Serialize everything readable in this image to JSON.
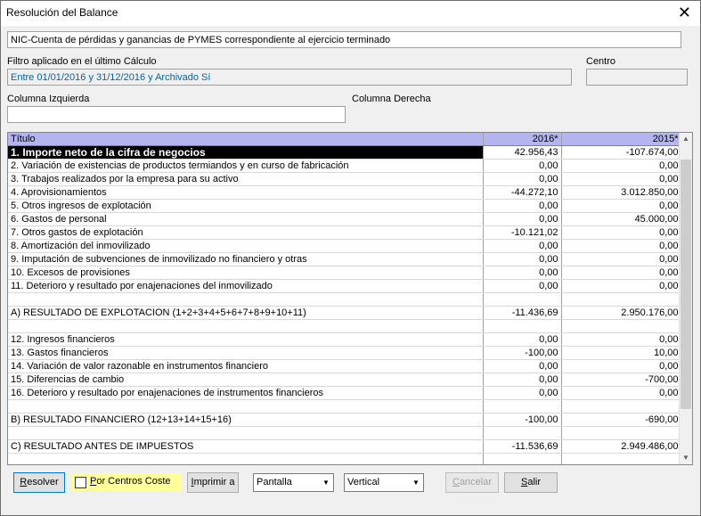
{
  "window": {
    "title": "Resolución del Balance",
    "close": "✕"
  },
  "report_name": "NIC-Cuenta de pérdidas y ganancias de PYMES correspondiente al ejercicio terminado",
  "filter_label": "Filtro aplicado en el último Cálculo",
  "filter_value": "Entre 01/01/2016 y 31/12/2016 y Archivado Sí",
  "centro_label": "Centro",
  "centro_value": "",
  "col_izq_label": "Columna Izquierda",
  "col_izq_value": "",
  "col_der_label": "Columna Derecha",
  "table": {
    "headers": [
      "Título",
      "2016*",
      "2015*"
    ],
    "rows": [
      [
        "1. Importe neto de la cifra de negocios",
        "42.956,43",
        "-107.674,00"
      ],
      [
        "2. Variación de existencias de productos termiandos y en curso de fabricación",
        "0,00",
        "0,00"
      ],
      [
        "3. Trabajos realizados por la empresa para su activo",
        "0,00",
        "0,00"
      ],
      [
        "4. Aprovisionamientos",
        "-44.272,10",
        "3.012.850,00"
      ],
      [
        "5. Otros ingresos de explotación",
        "0,00",
        "0,00"
      ],
      [
        "6. Gastos de personal",
        "0,00",
        "45.000,00"
      ],
      [
        "7. Otros gastos de explotación",
        "-10.121,02",
        "0,00"
      ],
      [
        "8. Amortización del inmovilizado",
        "0,00",
        "0,00"
      ],
      [
        "9. Imputación de subvenciones de inmovilizado no financiero y otras",
        "0,00",
        "0,00"
      ],
      [
        "10. Excesos de provisiones",
        "0,00",
        "0,00"
      ],
      [
        "11. Deterioro y resultado por enajenaciones del inmovilizado",
        "0,00",
        "0,00"
      ],
      [
        "",
        "",
        ""
      ],
      [
        "A) RESULTADO DE EXPLOTACION (1+2+3+4+5+6+7+8+9+10+11)",
        "-11.436,69",
        "2.950.176,00"
      ],
      [
        "",
        "",
        ""
      ],
      [
        "12. Ingresos financieros",
        "0,00",
        "0,00"
      ],
      [
        "13. Gastos financieros",
        "-100,00",
        "10,00"
      ],
      [
        "14. Variación de valor razonable en instrumentos financiero",
        "0,00",
        "0,00"
      ],
      [
        "15. Diferencias de cambio",
        "0,00",
        "-700,00"
      ],
      [
        "16. Deterioro y resultado por enajenaciones de instrumentos financieros",
        "0,00",
        "0,00"
      ],
      [
        "",
        "",
        ""
      ],
      [
        "B) RESULTADO FINANCIERO (12+13+14+15+16)",
        "-100,00",
        "-690,00"
      ],
      [
        "",
        "",
        ""
      ],
      [
        "C) RESULTADO ANTES DE IMPUESTOS",
        "-11.536,69",
        "2.949.486,00"
      ],
      [
        "",
        "",
        ""
      ]
    ]
  },
  "buttons": {
    "resolver": "Resolver",
    "por_centros": "Por Centros Coste",
    "imprimir": "Imprimir a",
    "pantalla": "Pantalla",
    "vertical": "Vertical",
    "cancelar": "Cancelar",
    "salir": "Salir"
  }
}
